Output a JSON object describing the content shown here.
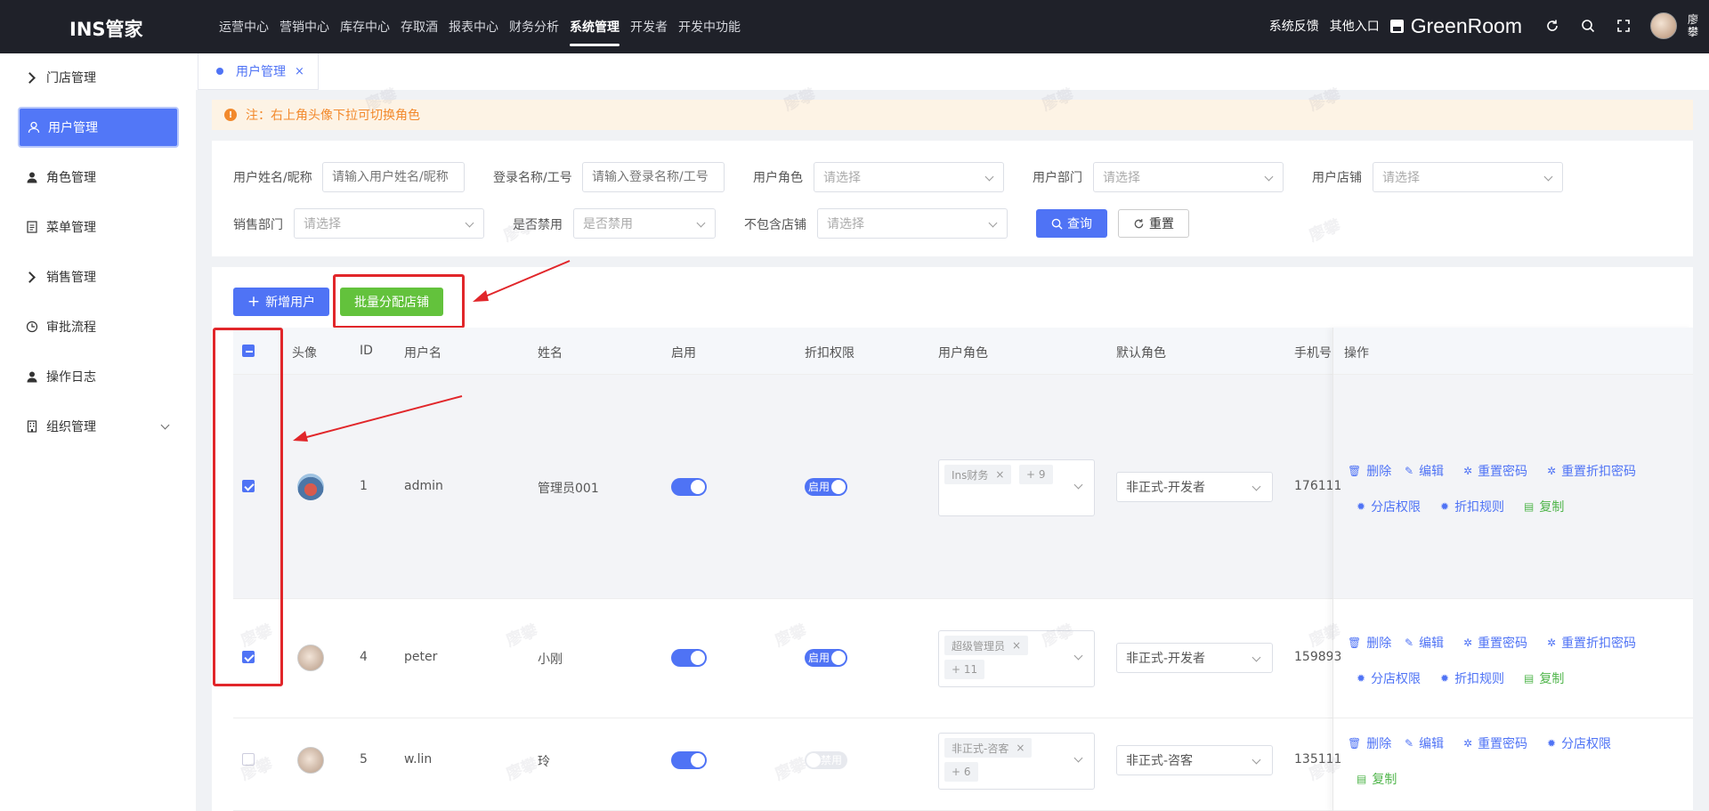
{
  "app": {
    "title": "INS管家"
  },
  "topnav": [
    "运营中心",
    "营销中心",
    "库存中心",
    "存取酒",
    "报表中心",
    "财务分析",
    "系统管理",
    "开发者",
    "开发中功能"
  ],
  "topnav_active": "系统管理",
  "topright": {
    "feedback": "系统反馈",
    "other_entry": "其他入口",
    "store_name": "GreenRoom",
    "user_name": "廖攀"
  },
  "sidebar": {
    "items": [
      {
        "label": "门店管理",
        "icon": "chevron-right-icon"
      },
      {
        "label": "用户管理",
        "icon": "user-outline-icon",
        "active": true
      },
      {
        "label": "角色管理",
        "icon": "user-icon"
      },
      {
        "label": "菜单管理",
        "icon": "document-icon"
      },
      {
        "label": "销售管理",
        "icon": "chevron-right-icon"
      },
      {
        "label": "审批流程",
        "icon": "clock-icon"
      },
      {
        "label": "操作日志",
        "icon": "user-icon"
      },
      {
        "label": "组织管理",
        "icon": "building-icon"
      }
    ]
  },
  "tab": {
    "label": "用户管理",
    "close": "×"
  },
  "notice": {
    "icon": "!",
    "text": "注：右上角头像下拉可切换角色"
  },
  "filter": {
    "name_label": "用户姓名/昵称",
    "name_placeholder": "请输入用户姓名/昵称",
    "login_label": "登录名称/工号",
    "login_placeholder": "请输入登录名称/工号",
    "role_label": "用户角色",
    "role_placeholder": "请选择",
    "dept_label": "用户部门",
    "dept_placeholder": "请选择",
    "store_label": "用户店铺",
    "store_placeholder": "请选择",
    "sales_dept_label": "销售部门",
    "sales_dept_placeholder": "请选择",
    "disabled_label": "是否禁用",
    "disabled_placeholder": "是否禁用",
    "exclude_store_label": "不包含店铺",
    "exclude_store_placeholder": "请选择",
    "query_label": "查询",
    "reset_label": "重置"
  },
  "toolbar": {
    "add_label": "新增用户",
    "batch_label": "批量分配店铺"
  },
  "table": {
    "headers": [
      "头像",
      "ID",
      "用户名",
      "姓名",
      "启用",
      "折扣权限",
      "用户角色",
      "默认角色",
      "手机号",
      "操作"
    ],
    "rows": [
      {
        "checked": true,
        "id": "1",
        "username": "admin",
        "name": "管理员001",
        "enabled": true,
        "discount": "启用",
        "discount_on": true,
        "role_tag": "Ins财务",
        "role_more": "+ 9",
        "default_role": "非正式-开发者",
        "phone": "176111",
        "ops": [
          "删除",
          "编辑",
          "重置密码",
          "重置折扣密码",
          "分店权限",
          "折扣规则",
          "复制"
        ]
      },
      {
        "checked": true,
        "id": "4",
        "username": "peter",
        "name": "小刚",
        "enabled": true,
        "discount": "启用",
        "discount_on": true,
        "role_tag": "超级管理员",
        "role_more": "+ 11",
        "default_role": "非正式-开发者",
        "phone": "159893",
        "ops": [
          "删除",
          "编辑",
          "重置密码",
          "重置折扣密码",
          "分店权限",
          "折扣规则",
          "复制"
        ]
      },
      {
        "checked": false,
        "id": "5",
        "username": "w.lin",
        "name": "玲",
        "enabled": true,
        "discount": "禁用",
        "discount_on": false,
        "role_tag": "非正式-咨客",
        "role_more": "+ 6",
        "default_role": "非正式-咨客",
        "phone": "135111",
        "ops": [
          "删除",
          "编辑",
          "重置密码",
          "分店权限",
          "复制"
        ]
      }
    ]
  },
  "watermark": "廖攀",
  "colors": {
    "primary": "#4f73f5",
    "success": "#63c23c",
    "danger_annotation": "#e1262a",
    "warning": "#f2892c",
    "topbar": "#1f2129"
  }
}
